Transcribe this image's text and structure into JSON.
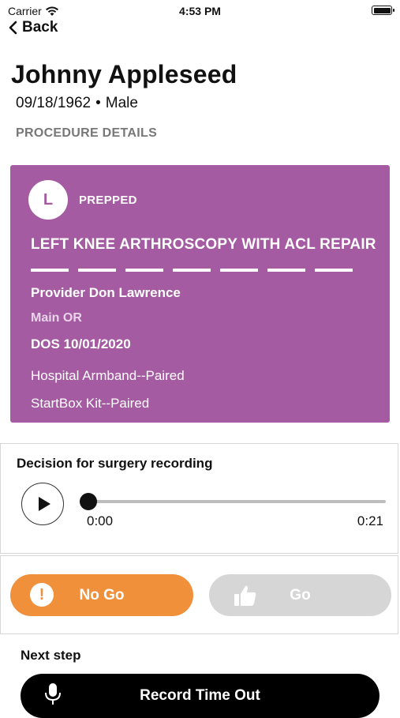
{
  "status_bar": {
    "carrier": "Carrier",
    "time": "4:53 PM"
  },
  "nav": {
    "back_label": "Back"
  },
  "patient": {
    "name": "Johnny Appleseed",
    "dob": "09/18/1962",
    "separator": "•",
    "sex": "Male"
  },
  "section_label": "PROCEDURE DETAILS",
  "procedure_card": {
    "background": "#a45ba2",
    "avatar_letter": "L",
    "status": "PREPPED",
    "procedure": "LEFT KNEE ARTHROSCOPY WITH ACL REPAIR",
    "provider": "Provider Don Lawrence",
    "location": "Main OR",
    "dos": "DOS 10/01/2020",
    "armband": "Hospital Armband--Paired",
    "kit": "StartBox Kit--Paired"
  },
  "recording": {
    "title": "Decision for surgery recording",
    "current_time": "0:00",
    "total_time": "0:21",
    "progress": 0.0
  },
  "decision": {
    "no_go_label": "No Go",
    "no_go_color": "#f0903a",
    "go_label": "Go",
    "go_color": "#d6d6d6"
  },
  "next_step": {
    "label": "Next step",
    "button_label": "Record Time Out"
  }
}
